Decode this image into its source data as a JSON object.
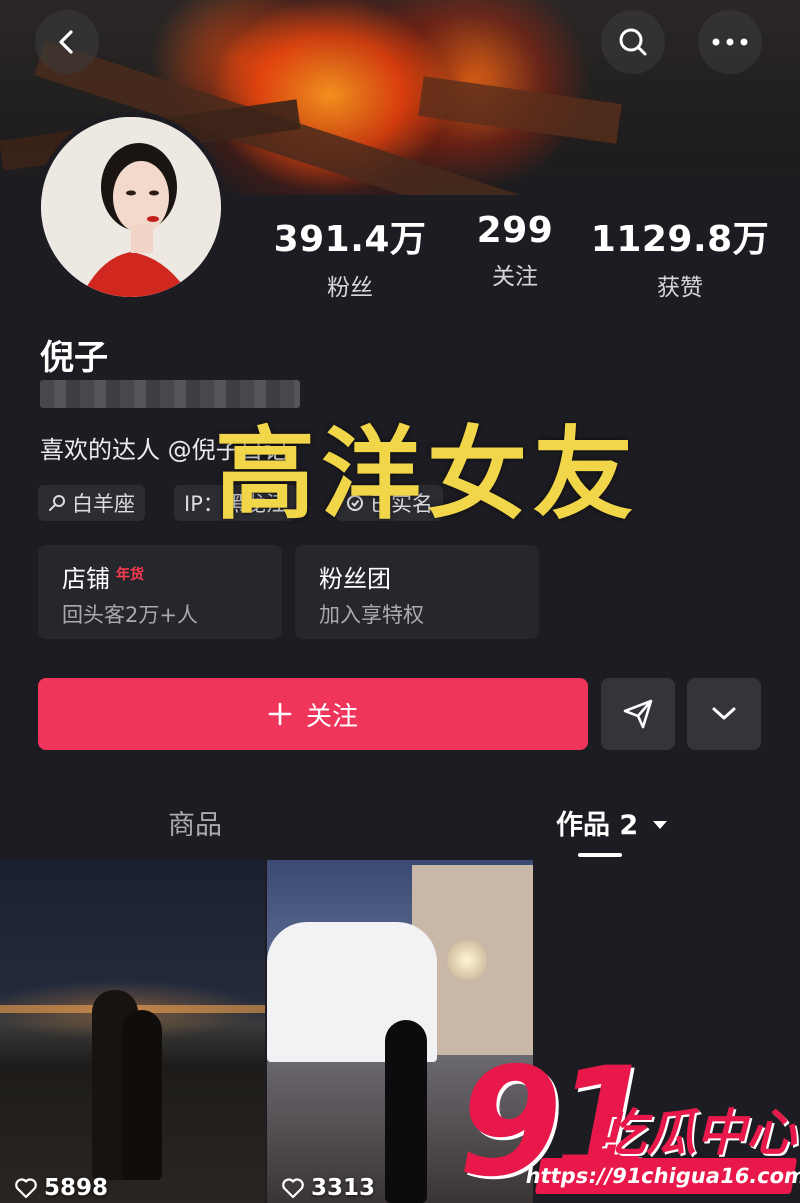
{
  "header": {
    "icons": [
      "back-icon",
      "search-icon",
      "more-icon"
    ]
  },
  "stats": [
    {
      "value": "391.4万",
      "label": "粉丝"
    },
    {
      "value": "299",
      "label": "关注"
    },
    {
      "value": "1129.8万",
      "label": "获赞"
    }
  ],
  "profile": {
    "name": "倪子",
    "bio": "喜欢的达人 @倪子日记"
  },
  "tags": [
    {
      "icon": "search-icon",
      "label": "白羊座"
    },
    {
      "icon": "",
      "label": "IP：黑龙江"
    },
    {
      "icon": "verified-icon",
      "label": "已实名"
    }
  ],
  "overlay": {
    "text": "高洋女友",
    "color": "#f2d64a"
  },
  "features": [
    {
      "title": "店铺",
      "badge": "年货",
      "sub": "回头客2万+人"
    },
    {
      "title": "粉丝团",
      "badge": "",
      "sub": "加入享特权"
    }
  ],
  "actions": {
    "follow_label": "关注",
    "follow_color": "#f0355a"
  },
  "tabs": {
    "goods": "商品",
    "works": "作品 2"
  },
  "posts": [
    {
      "likes": "5898"
    },
    {
      "likes": "3313"
    }
  ],
  "watermark": {
    "number": "91",
    "name": "吃瓜中心",
    "url": "https://91chigua16.com",
    "color": "#e8194a"
  }
}
